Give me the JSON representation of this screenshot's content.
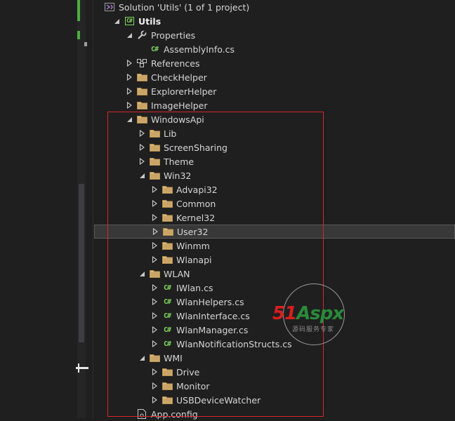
{
  "solution": {
    "label": "Solution 'Utils' (1 of 1 project)"
  },
  "tree": [
    {
      "id": "utils",
      "label": "Utils",
      "icon": "csharp-project-icon",
      "expander": "expanded",
      "bold": true
    },
    {
      "id": "properties",
      "label": "Properties",
      "icon": "wrench-icon",
      "expander": "expanded"
    },
    {
      "id": "assemblyinfo",
      "label": "AssemblyInfo.cs",
      "icon": "csharp-file-icon",
      "expander": "none"
    },
    {
      "id": "references",
      "label": "References",
      "icon": "references-icon",
      "expander": "collapsed"
    },
    {
      "id": "checkhelper",
      "label": "CheckHelper",
      "icon": "folder-icon",
      "expander": "collapsed"
    },
    {
      "id": "explorerhelper",
      "label": "ExplorerHelper",
      "icon": "folder-icon",
      "expander": "collapsed"
    },
    {
      "id": "imagehelper",
      "label": "ImageHelper",
      "icon": "folder-icon",
      "expander": "collapsed"
    },
    {
      "id": "windowsapi",
      "label": "WindowsApi",
      "icon": "folder-icon",
      "expander": "expanded"
    },
    {
      "id": "lib",
      "label": "Lib",
      "icon": "folder-icon",
      "expander": "collapsed"
    },
    {
      "id": "screensharing",
      "label": "ScreenSharing",
      "icon": "folder-icon",
      "expander": "collapsed"
    },
    {
      "id": "theme",
      "label": "Theme",
      "icon": "folder-icon",
      "expander": "collapsed"
    },
    {
      "id": "win32",
      "label": "Win32",
      "icon": "folder-icon",
      "expander": "expanded"
    },
    {
      "id": "advapi32",
      "label": "Advapi32",
      "icon": "folder-icon",
      "expander": "collapsed"
    },
    {
      "id": "common",
      "label": "Common",
      "icon": "folder-icon",
      "expander": "collapsed"
    },
    {
      "id": "kernel32",
      "label": "Kernel32",
      "icon": "folder-icon",
      "expander": "collapsed"
    },
    {
      "id": "user32",
      "label": "User32",
      "icon": "folder-icon",
      "expander": "collapsed",
      "selected": true
    },
    {
      "id": "winmm",
      "label": "Winmm",
      "icon": "folder-icon",
      "expander": "collapsed"
    },
    {
      "id": "wlanapi",
      "label": "Wlanapi",
      "icon": "folder-icon",
      "expander": "collapsed"
    },
    {
      "id": "wlan",
      "label": "WLAN",
      "icon": "folder-icon",
      "expander": "expanded"
    },
    {
      "id": "iwlan",
      "label": "IWlan.cs",
      "icon": "csharp-file-icon",
      "expander": "collapsed"
    },
    {
      "id": "wlanhelpers",
      "label": "WlanHelpers.cs",
      "icon": "csharp-file-icon",
      "expander": "collapsed"
    },
    {
      "id": "wlaninterface",
      "label": "WlanInterface.cs",
      "icon": "csharp-file-icon",
      "expander": "collapsed"
    },
    {
      "id": "wlanmanager",
      "label": "WlanManager.cs",
      "icon": "csharp-file-icon",
      "expander": "collapsed"
    },
    {
      "id": "wlannotification",
      "label": "WlanNotificationStructs.cs",
      "icon": "csharp-file-icon",
      "expander": "collapsed"
    },
    {
      "id": "wmi",
      "label": "WMI",
      "icon": "folder-icon",
      "expander": "expanded"
    },
    {
      "id": "drive",
      "label": "Drive",
      "icon": "folder-icon",
      "expander": "collapsed"
    },
    {
      "id": "monitor",
      "label": "Monitor",
      "icon": "folder-icon",
      "expander": "collapsed"
    },
    {
      "id": "usbdevicewatcher",
      "label": "USBDeviceWatcher",
      "icon": "folder-icon",
      "expander": "collapsed"
    },
    {
      "id": "appconfig",
      "label": "App.config",
      "icon": "config-file-icon",
      "expander": "none"
    }
  ],
  "watermark": {
    "brand_red": "51",
    "brand_green": "Aspx",
    "sub": "源码服务专家"
  },
  "colors": {
    "folder": "#dcb67a",
    "csharp": "#7fd65f",
    "highlight": "#d6262c",
    "background": "#1f1f1f"
  }
}
